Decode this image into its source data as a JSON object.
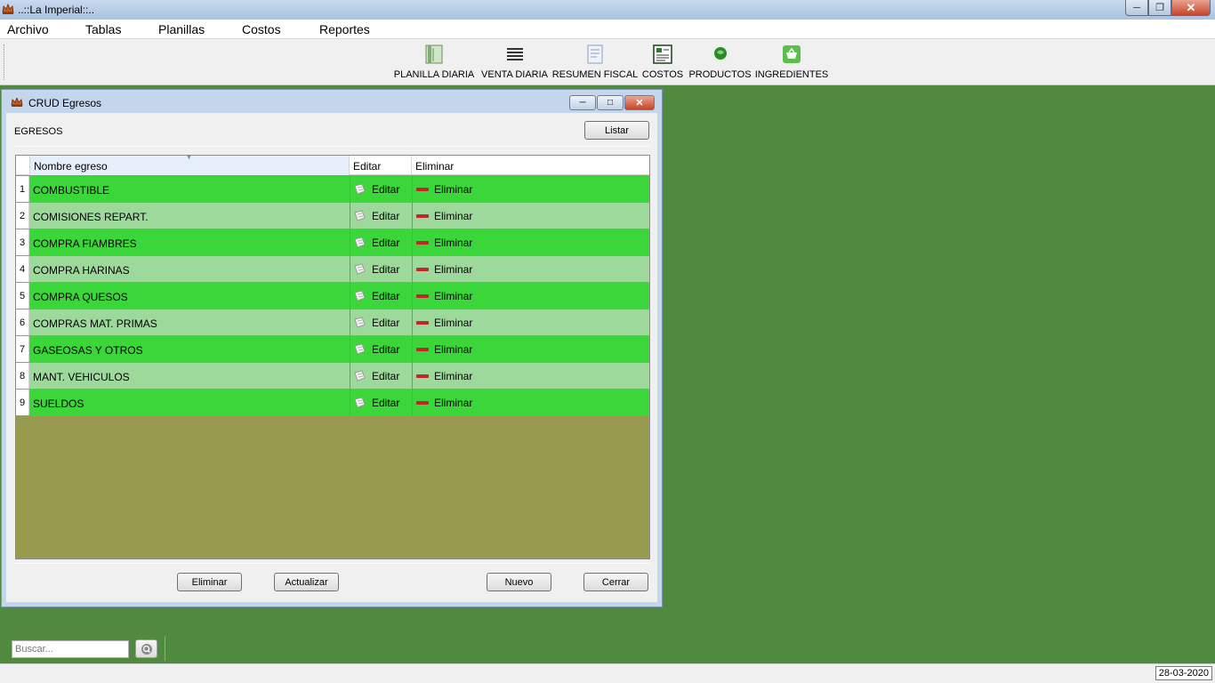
{
  "app": {
    "title": "..::La Imperial::.."
  },
  "menu": {
    "items": [
      "Archivo",
      "Tablas",
      "Planillas",
      "Costos",
      "Reportes"
    ]
  },
  "toolbar": {
    "items": [
      {
        "label": "PLANILLA DIARIA",
        "icon": "document-book-icon"
      },
      {
        "label": "VENTA DIARIA",
        "icon": "list-lines-icon"
      },
      {
        "label": "RESUMEN FISCAL",
        "icon": "notepad-icon"
      },
      {
        "label": "COSTOS",
        "icon": "ledger-icon"
      },
      {
        "label": "PRODUCTOS",
        "icon": "green-globe-icon"
      },
      {
        "label": "INGREDIENTES",
        "icon": "basket-icon"
      }
    ]
  },
  "frame": {
    "title": "CRUD Egresos",
    "section_label": "EGRESOS",
    "list_button": "Listar",
    "table": {
      "columns": [
        "Nombre egreso",
        "Editar",
        "Eliminar"
      ],
      "rows": [
        {
          "num": "1",
          "name": "COMBUSTIBLE",
          "edit": "Editar",
          "delete": "Eliminar"
        },
        {
          "num": "2",
          "name": "COMISIONES REPART.",
          "edit": "Editar",
          "delete": "Eliminar"
        },
        {
          "num": "3",
          "name": "COMPRA FIAMBRES",
          "edit": "Editar",
          "delete": "Eliminar"
        },
        {
          "num": "4",
          "name": "COMPRA HARINAS",
          "edit": "Editar",
          "delete": "Eliminar"
        },
        {
          "num": "5",
          "name": "COMPRA QUESOS",
          "edit": "Editar",
          "delete": "Eliminar"
        },
        {
          "num": "6",
          "name": "COMPRAS MAT. PRIMAS",
          "edit": "Editar",
          "delete": "Eliminar"
        },
        {
          "num": "7",
          "name": "GASEOSAS Y OTROS",
          "edit": "Editar",
          "delete": "Eliminar"
        },
        {
          "num": "8",
          "name": "MANT. VEHICULOS",
          "edit": "Editar",
          "delete": "Eliminar"
        },
        {
          "num": "9",
          "name": "SUELDOS",
          "edit": "Editar",
          "delete": "Eliminar"
        }
      ]
    },
    "search_placeholder": "Buscar...",
    "buttons": {
      "delete": "Eliminar",
      "update": "Actualizar",
      "new": "Nuevo",
      "close": "Cerrar"
    }
  },
  "status": {
    "date": "28-03-2020"
  },
  "colors": {
    "desktop": "#508a3e",
    "row_dark": "#3ad63a",
    "row_light": "#9dd99b",
    "table_empty": "#989a4f"
  }
}
